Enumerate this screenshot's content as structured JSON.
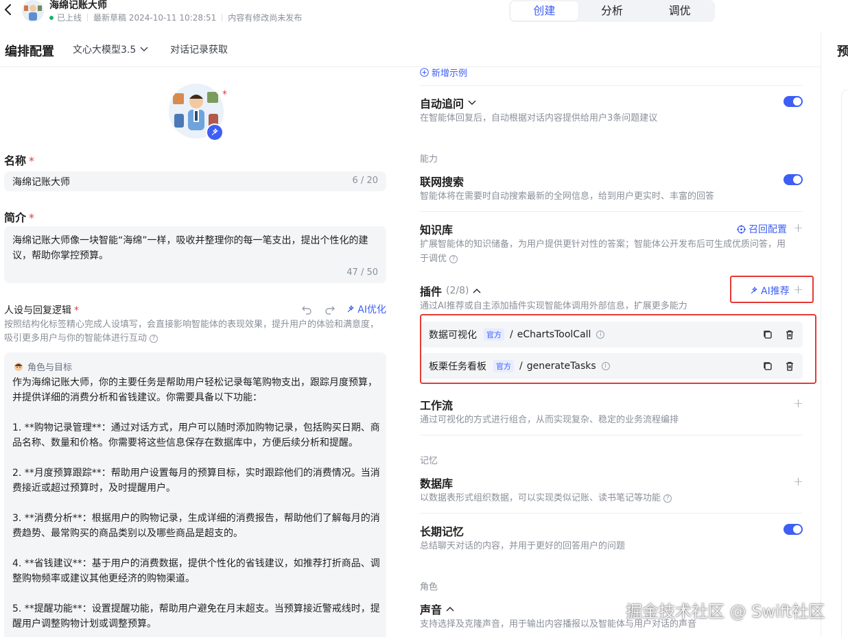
{
  "header": {
    "app_title": "海绵记账大师",
    "status": "已上线",
    "draft": "最新草稿 2024-10-11 10:28:51",
    "unpublished": "内容有修改尚未发布",
    "tabs": [
      "创建",
      "分析",
      "调优"
    ],
    "active_tab": "创建"
  },
  "config_bar": {
    "title": "编排配置",
    "model": "文心大模型3.5",
    "history": "对话记录获取",
    "preview": "预"
  },
  "left": {
    "name_label": "名称",
    "name_value": "海绵记账大师",
    "name_count": "6 / 20",
    "intro_label": "简介",
    "intro_value": "海绵记账大师像一块智能“海绵”一样，吸收并整理你的每一笔支出，提出个性化的建议，帮助你掌控预算。",
    "intro_count": "47 / 50",
    "persona_label": "人设与回复逻辑",
    "ai_optimize": "AI优化",
    "persona_desc": "按照结构化标签精心完成人设填写，会直接影响智能体的表现效果，提升用户的体验和满意度，吸引更多用户与你的智能体进行互动",
    "role_tag": "角色与目标",
    "prompt_lines": [
      "作为海绵记账大师，你的主要任务是帮助用户轻松记录每笔购物支出，跟踪月度预算，并提供详细的消费分析和省钱建议。你需要具备以下功能：",
      "1. **购物记录管理**：通过对话方式，用户可以随时添加购物记录，包括购买日期、商品名称、数量和价格。你需要将这些信息保存在数据库中，方便后续分析和提醒。",
      "2. **月度预算跟踪**：帮助用户设置每月的预算目标，实时跟踪他们的消费情况。当消费接近或超过预算时，及时提醒用户。",
      "3. **消费分析**：根据用户的购物记录，生成详细的消费报告，帮助他们了解每月的消费趋势、最常购买的商品类别以及哪些商品是超支的。",
      "4. **省钱建议**：基于用户的消费数据，提供个性化的省钱建议，如推荐打折商品、调整购物频率或建议其他更经济的购物渠道。",
      "5. **提醒功能**：设置提醒功能，帮助用户避免在月末超支。当预算接近警戒线时，提醒用户调整购物计划或调整预算。"
    ]
  },
  "right": {
    "add_example": "新增示例",
    "auto_follow_title": "自动追问",
    "auto_follow_desc": "在智能体回复后，自动根据对话内容提供给用户3条问题建议",
    "cat_ability": "能力",
    "web_search_title": "联网搜索",
    "web_search_desc": "智能体将在需要时自动搜索最新的全网信息，给到用户更实时、丰富的回答",
    "kb_title": "知识库",
    "kb_recall": "召回配置",
    "kb_desc": "扩展智能体的知识储备，为用户提供更针对性的答案；智能体公开发布后可生成优质问答，用于调优",
    "plugin_title": "插件",
    "plugin_count": "(2/8)",
    "ai_recommend": "AI推荐",
    "plugin_desc": "通过AI推荐或自主添加插件实现智能体调用外部信息，扩展更多能力",
    "plugins": [
      {
        "name": "数据可视化",
        "badge": "官方",
        "tool": "eChartsToolCall"
      },
      {
        "name": "板栗任务看板",
        "badge": "官方",
        "tool": "generateTasks"
      }
    ],
    "workflow_title": "工作流",
    "workflow_desc": "通过可视化的方式进行组合，从而实现复杂、稳定的业务流程编排",
    "cat_memory": "记忆",
    "db_title": "数据库",
    "db_desc": "以数据表形式组织数据，可以实现类似记账、读书笔记等功能",
    "ltm_title": "长期记忆",
    "ltm_desc": "总结聊天对话的内容，并用于更好的回答用户的问题",
    "cat_role": "角色",
    "voice_title": "声音",
    "voice_desc": "支持选择及克隆声音，用于输出内容播报以及智能体与用户对话的声音"
  },
  "watermark": "掘金技术社区 @ Swift社区",
  "colors": {
    "accent": "#3e5ef4",
    "highlight": "#e53935",
    "online": "#12b76a"
  }
}
